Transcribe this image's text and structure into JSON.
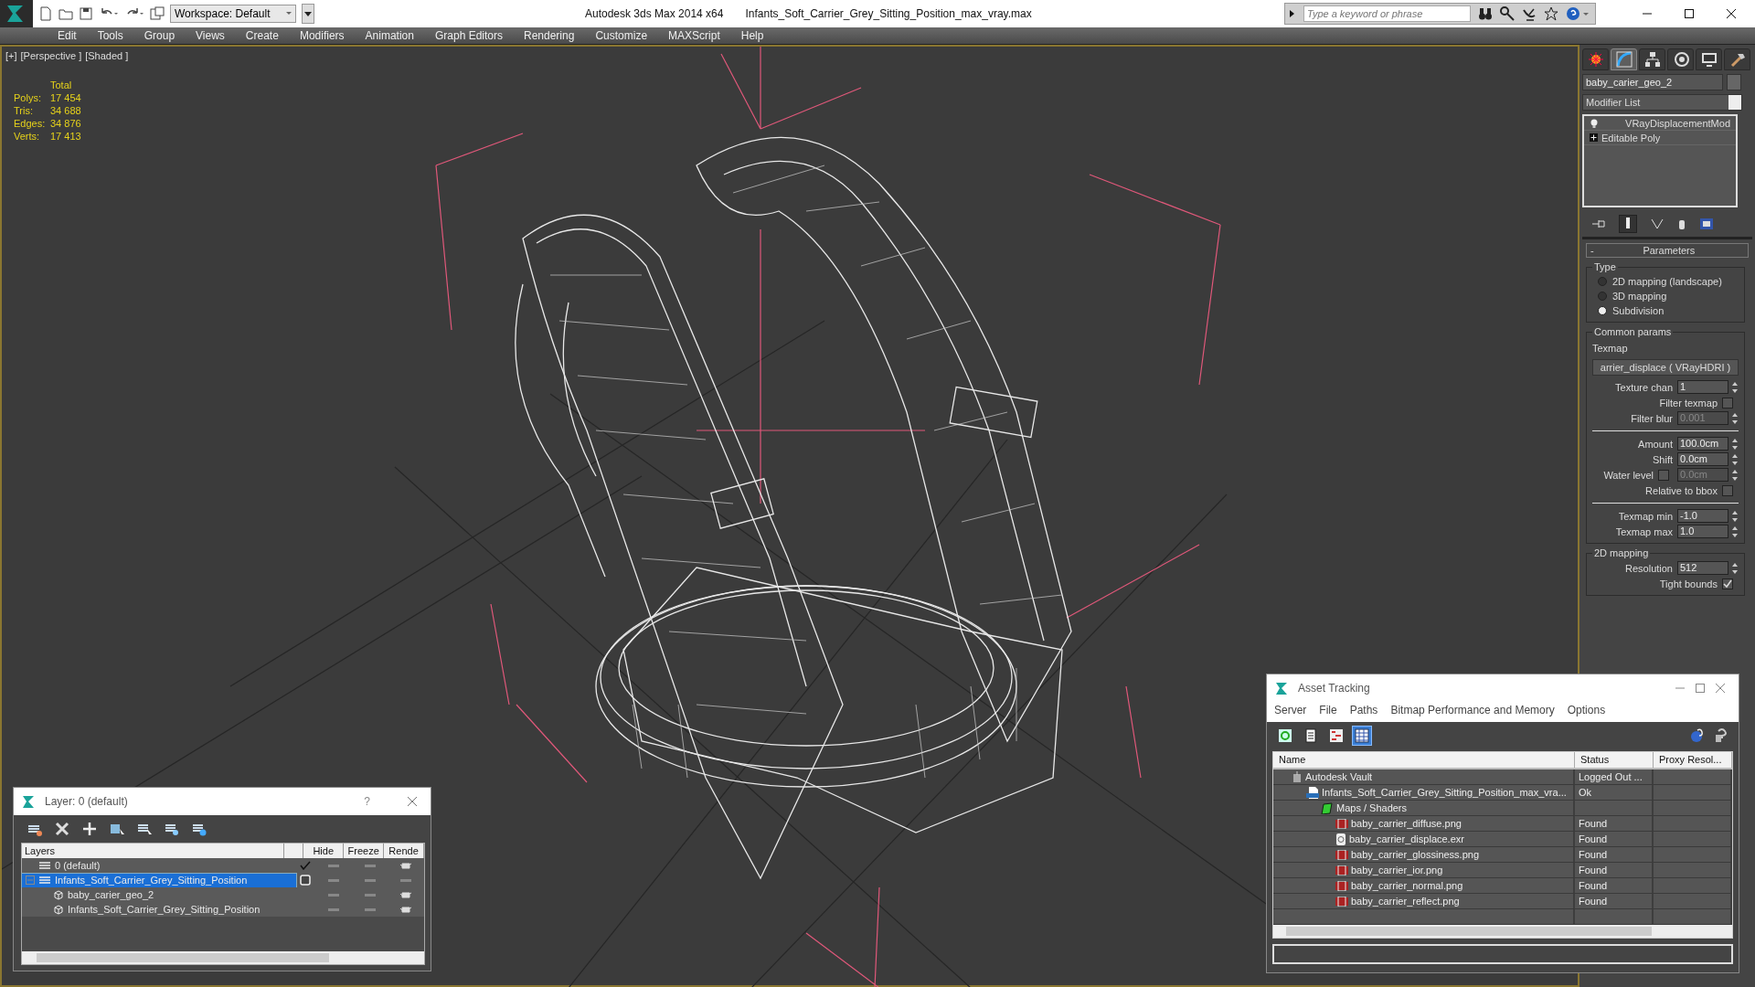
{
  "title_bar": {
    "workspace": "Workspace: Default",
    "app_title": "Autodesk 3ds Max  2014 x64",
    "file_title": "Infants_Soft_Carrier_Grey_Sitting_Position_max_vray.max",
    "search": {
      "placeholder": "Type a keyword or phrase"
    }
  },
  "menu": [
    "Edit",
    "Tools",
    "Group",
    "Views",
    "Create",
    "Modifiers",
    "Animation",
    "Graph Editors",
    "Rendering",
    "Customize",
    "MAXScript",
    "Help"
  ],
  "viewport": {
    "labels": [
      "[+]",
      "[Perspective ]",
      "[Shaded ]"
    ],
    "stats": {
      "header": "Total",
      "rows": [
        {
          "label": "Polys:",
          "value": "17 454"
        },
        {
          "label": "Tris:",
          "value": "34 688"
        },
        {
          "label": "Edges:",
          "value": "34 876"
        },
        {
          "label": "Verts:",
          "value": "17 413"
        }
      ]
    }
  },
  "command_panel": {
    "tabs": [
      {
        "selected": false
      },
      {
        "selected": true
      },
      {
        "selected": false
      },
      {
        "selected": false
      },
      {
        "selected": false
      },
      {
        "selected": false
      }
    ],
    "object_name": "baby_carier_geo_2",
    "modifier_list": "Modifier List",
    "stack": [
      {
        "kind": "modifier",
        "label": "VRayDisplacementMod"
      },
      {
        "kind": "base",
        "label": "Editable Poly"
      }
    ],
    "rollout": {
      "collapse": "-",
      "title": "Parameters"
    },
    "type_group": {
      "title": "Type",
      "options": [
        {
          "label": "2D mapping (landscape)",
          "selected": false
        },
        {
          "label": "3D mapping",
          "selected": false
        },
        {
          "label": "Subdivision",
          "selected": true
        }
      ]
    },
    "common_group": {
      "title": "Common params",
      "texmap_label": "Texmap",
      "texmap_button": "arrier_displace  ( VRayHDRI )",
      "rows": [
        {
          "kind": "spinner",
          "label": "Texture chan",
          "value": "1",
          "disabled": false
        },
        {
          "kind": "check",
          "label": "Filter texmap",
          "checked": false
        },
        {
          "kind": "spinner",
          "label": "Filter blur",
          "value": "0.001",
          "disabled": true
        },
        {
          "kind": "divider"
        },
        {
          "kind": "spinner",
          "label": "Amount",
          "value": "100.0cm",
          "disabled": false
        },
        {
          "kind": "spinner",
          "label": "Shift",
          "value": "0.0cm",
          "disabled": false
        },
        {
          "kind": "check_spinner",
          "label": "Water level",
          "checked": false,
          "value": "0.0cm",
          "disabled": true
        },
        {
          "kind": "check",
          "label": "Relative to bbox",
          "checked": false
        },
        {
          "kind": "divider"
        },
        {
          "kind": "spinner",
          "label": "Texmap min",
          "value": "-1.0",
          "disabled": false
        },
        {
          "kind": "spinner",
          "label": "Texmap max",
          "value": "1.0",
          "disabled": false
        }
      ]
    },
    "mapping_group": {
      "title": "2D mapping",
      "rows": [
        {
          "kind": "spinner",
          "label": "Resolution",
          "value": "512",
          "disabled": false
        },
        {
          "kind": "check",
          "label": "Tight bounds",
          "checked": true
        }
      ]
    }
  },
  "layer_dialog": {
    "title": "Layer: 0 (default)",
    "help": "?",
    "columns": [
      "Layers",
      "Hide",
      "Freeze",
      "Rende"
    ],
    "rows": [
      {
        "kind": "layer",
        "label": "0 (default)",
        "selected": false,
        "active": true,
        "renderable": true,
        "children": []
      },
      {
        "kind": "layer",
        "label": "Infants_Soft_Carrier_Grey_Sitting_Position",
        "selected": true,
        "active": false,
        "renderable": false,
        "children": [
          {
            "kind": "object",
            "label": "baby_carier_geo_2",
            "selected": false,
            "renderable": true
          },
          {
            "kind": "object",
            "label": "Infants_Soft_Carrier_Grey_Sitting_Position",
            "selected": false,
            "renderable": true
          }
        ]
      }
    ]
  },
  "asset_dialog": {
    "title": "Asset Tracking",
    "menu": [
      "Server",
      "File",
      "Paths",
      "Bitmap Performance and Memory",
      "Options"
    ],
    "toolbar": [
      {
        "selected": false
      },
      {
        "selected": false
      },
      {
        "selected": false
      },
      {
        "selected": true
      }
    ],
    "columns": [
      "Name",
      "Status",
      "Proxy Resol..."
    ],
    "rows": [
      {
        "kind": "vault",
        "name": "Autodesk Vault",
        "status": "Logged Out ...",
        "children": [
          {
            "kind": "max",
            "name": "Infants_Soft_Carrier_Grey_Sitting_Position_max_vra...",
            "status": "Ok",
            "children": [
              {
                "kind": "folder",
                "name": "Maps / Shaders",
                "children": [
                  {
                    "kind": "png",
                    "name": "baby_carrier_diffuse.png",
                    "status": "Found"
                  },
                  {
                    "kind": "exr",
                    "name": "baby_carrier_displace.exr",
                    "status": "Found"
                  },
                  {
                    "kind": "png",
                    "name": "baby_carrier_glossiness.png",
                    "status": "Found"
                  },
                  {
                    "kind": "png",
                    "name": "baby_carrier_ior.png",
                    "status": "Found"
                  },
                  {
                    "kind": "png",
                    "name": "baby_carrier_normal.png",
                    "status": "Found"
                  },
                  {
                    "kind": "png",
                    "name": "baby_carrier_reflect.png",
                    "status": "Found"
                  }
                ]
              }
            ]
          }
        ]
      }
    ]
  }
}
